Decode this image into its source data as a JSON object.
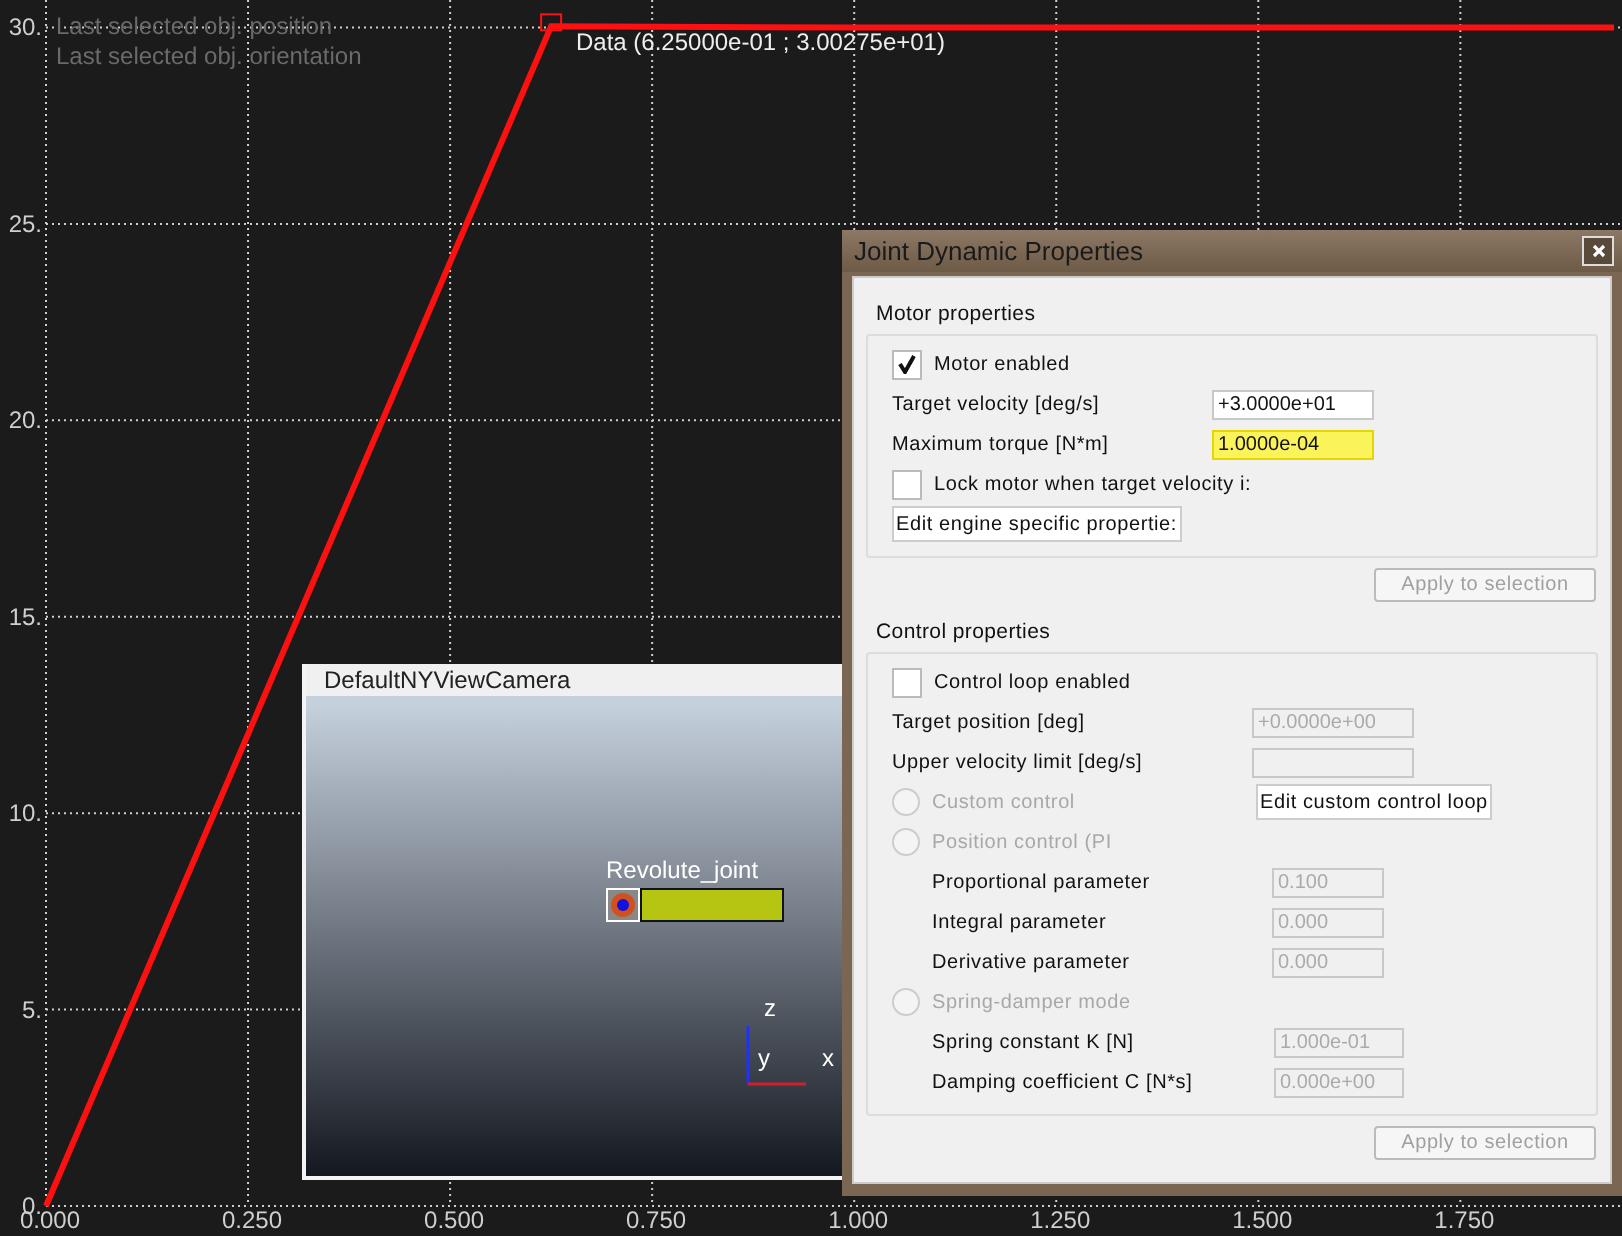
{
  "plot": {
    "overlay_labels": [
      "Last selected obj. position",
      "Last selected obj. orientation"
    ],
    "tooltip": "(6.25000e-01 ; 3.00275e+01)",
    "chart_data": {
      "type": "line",
      "grid": true,
      "x": [
        0,
        0.625,
        1.0,
        1.5,
        1.94
      ],
      "series": [
        {
          "name": "Data",
          "color": "#ff1010",
          "values": [
            0,
            30.03,
            30,
            30,
            30
          ]
        }
      ],
      "xlim": [
        0,
        1.95
      ],
      "ylim": [
        0,
        30.7
      ],
      "xticks": [
        {
          "value": 0,
          "label": "0.000"
        },
        {
          "value": 0.25,
          "label": "0.250"
        },
        {
          "value": 0.5,
          "label": "0.500"
        },
        {
          "value": 0.75,
          "label": "0.750"
        },
        {
          "value": 1,
          "label": "1.000"
        },
        {
          "value": 1.25,
          "label": "1.250"
        },
        {
          "value": 1.5,
          "label": "1.500"
        },
        {
          "value": 1.75,
          "label": "1.750"
        }
      ],
      "yticks": [
        {
          "value": 0,
          "label": "0."
        },
        {
          "value": 5,
          "label": "5."
        },
        {
          "value": 10,
          "label": "10."
        },
        {
          "value": 15,
          "label": "15."
        },
        {
          "value": 20,
          "label": "20."
        },
        {
          "value": 25,
          "label": "25."
        },
        {
          "value": 30,
          "label": "30."
        }
      ]
    }
  },
  "camera": {
    "title": "DefaultNYViewCamera",
    "joint_label": "Revolute_joint",
    "axis_labels": [
      "z",
      "y",
      "x"
    ]
  },
  "dialog": {
    "title": "Joint Dynamic Properties",
    "motor": {
      "heading": "Motor properties",
      "enabled": {
        "label": "Motor enabled",
        "checked": true
      },
      "fields": [
        {
          "label": "Target velocity [deg/s]",
          "value": "+3.0000e+01",
          "highlighted": false
        },
        {
          "label": "Maximum torque [N*m]",
          "value": "1.0000e-04",
          "highlighted": true
        }
      ],
      "lock": {
        "label": "Lock motor when target velocity i:",
        "checked": false
      },
      "engine_button": "Edit engine specific propertie:",
      "apply": "Apply to selection"
    },
    "control": {
      "heading": "Control properties",
      "enabled": {
        "label": "Control loop enabled",
        "checked": false
      },
      "fields": [
        {
          "label": "Target position [deg]",
          "value": "+0.0000e+00",
          "disabled": true
        },
        {
          "label": "Upper velocity limit [deg/s]",
          "disabled": true
        }
      ],
      "modes": [
        {
          "label": "Custom control",
          "selected": false,
          "disabled": true,
          "button": "Edit custom control loop"
        },
        {
          "label": "Position control (PI",
          "selected": false,
          "disabled": true,
          "params": [
            {
              "label": "Proportional parameter",
              "value": "0.100"
            },
            {
              "label": "Integral parameter",
              "value": "0.000"
            },
            {
              "label": "Derivative parameter",
              "value": "0.000"
            }
          ]
        },
        {
          "label": "Spring-damper mode",
          "selected": false,
          "disabled": true,
          "params": [
            {
              "label": "Spring constant K [N]",
              "value": "1.000e-01"
            },
            {
              "label": "Damping coefficient C [N*s]",
              "value": "0.000e+00"
            }
          ]
        }
      ],
      "apply": "Apply to selection"
    }
  }
}
